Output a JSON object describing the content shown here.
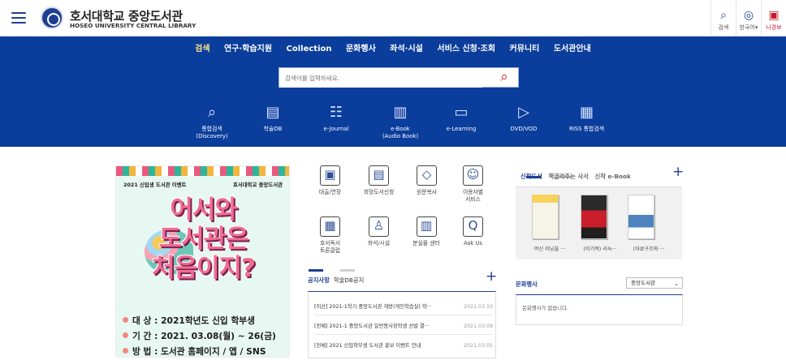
{
  "header": {
    "title_ko": "호서대학교 중앙도서관",
    "title_en": "HOSEO UNIVERSITY CENTRAL LIBRARY",
    "tools": [
      {
        "icon": "search-icon",
        "label": "검색"
      },
      {
        "icon": "globe-icon",
        "label": "한국어▾"
      },
      {
        "icon": "person-icon",
        "label": "나경보"
      }
    ]
  },
  "nav": {
    "menu": [
      "검색",
      "연구·학습지원",
      "Collection",
      "문화행사",
      "좌석·시설",
      "서비스 신청·조회",
      "커뮤니티",
      "도서관안내"
    ],
    "search_placeholder": "검색어를 입력하세요.",
    "quick": [
      {
        "icon": "search-icon",
        "label": "통합검색\n(Discovery)"
      },
      {
        "icon": "database-icon",
        "label": "학술DB"
      },
      {
        "icon": "journal-icon",
        "label": "e-Journal"
      },
      {
        "icon": "ebook-icon",
        "label": "e-Book\n(Audio Book)"
      },
      {
        "icon": "monitor-icon",
        "label": "e-Learning"
      },
      {
        "icon": "play-icon",
        "label": "DVD/VOD"
      },
      {
        "icon": "riss-icon",
        "label": "RISS 통합검색"
      }
    ]
  },
  "banner": {
    "event_label": "2021 신입생 도서관 이벤트",
    "library_label": "호서대학교 중앙도서관",
    "headline": [
      "어서와",
      "도서관은",
      "처음이지?"
    ],
    "details": [
      "대 상 : 2021학년도 신입 학부생",
      "기 간 : 2021. 03.08(월) ~ 26(금)",
      "방 법 : 도서관 홈페이지 / 앱 / SNS"
    ]
  },
  "services": [
    {
      "icon": "loan-icon",
      "label": "대출/연장"
    },
    {
      "icon": "request-book-icon",
      "label": "희망도서신청"
    },
    {
      "icon": "copy-icon",
      "label": "원문복사"
    },
    {
      "icon": "users-icon",
      "label": "이용자별\n서비스"
    },
    {
      "icon": "reading-club-icon",
      "label": "호서독서\n토론클럽"
    },
    {
      "icon": "seat-icon",
      "label": "좌석/시설"
    },
    {
      "icon": "lost-found-icon",
      "label": "분실물 센터"
    },
    {
      "icon": "qa-icon",
      "label": "Ask Us"
    }
  ],
  "books": {
    "tabs": [
      "신착도서",
      "책골라주는 사서",
      "신착 e-Book"
    ],
    "items": [
      {
        "caption": "머신 러닝을 ···"
      },
      {
        "caption": "(이기적) 리눅···"
      },
      {
        "caption": "(자료구조와 ···"
      }
    ]
  },
  "notices": {
    "tabs": [
      "공지사항",
      "학술DB공지"
    ],
    "rows": [
      {
        "title": "[이산] 2021-1학기 중앙도서관 개방(개인학습실) 학···",
        "date": "2021.03.10"
      },
      {
        "title": "[전체] 2021-1 중앙도서관 일반봉사장학생 선발 결···",
        "date": "2021.03.09"
      },
      {
        "title": "[전체] 2021 신입학부생 도서관 홍보 이벤트 안내",
        "date": "2021.03.05"
      }
    ]
  },
  "events": {
    "title": "문화행사",
    "select": "중앙도서관",
    "empty_text": "문화행사가 없습니다."
  },
  "colors": {
    "navy": "#0a3d9c",
    "brand": "#1d3f91",
    "search_red": "#d4302b",
    "banner_pink": "#ef6d91"
  }
}
